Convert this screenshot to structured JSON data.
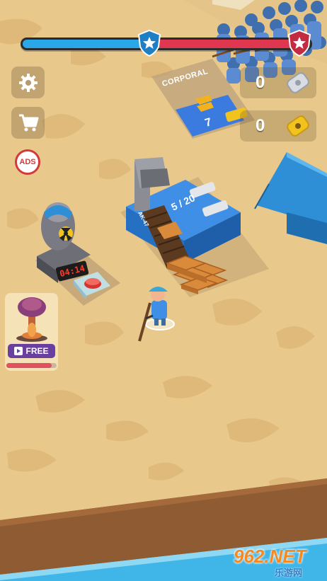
{
  "top_bar": {
    "blue_fraction": 0.44,
    "red_fraction": 0.54,
    "blue_color": "#2aa7e8",
    "red_color": "#e0364f",
    "left_badge_icon": "star-shield-icon",
    "right_badge_icon": "star-shield-icon"
  },
  "left_menu": {
    "settings_icon": "gear-icon",
    "shop_icon": "cart-icon",
    "ads_label": "ADS"
  },
  "currencies": {
    "silver": {
      "value": "0",
      "icon": "silver-dogtag-icon"
    },
    "gold": {
      "value": "0",
      "icon": "gold-dogtag-icon"
    }
  },
  "rank": {
    "title": "CORPORAL",
    "value": "7",
    "icon": "chevron-rank-icon"
  },
  "nuke_station": {
    "timer": "04:14",
    "icon": "nuke-icon"
  },
  "ammo_machine": {
    "count": "5 / 20",
    "weapon": "AK-47"
  },
  "free_reward": {
    "label": "FREE",
    "icon": "video-play-icon",
    "progress_fraction": 0.9
  },
  "watermark": {
    "top": "962.NET",
    "bottom": "乐游网"
  }
}
